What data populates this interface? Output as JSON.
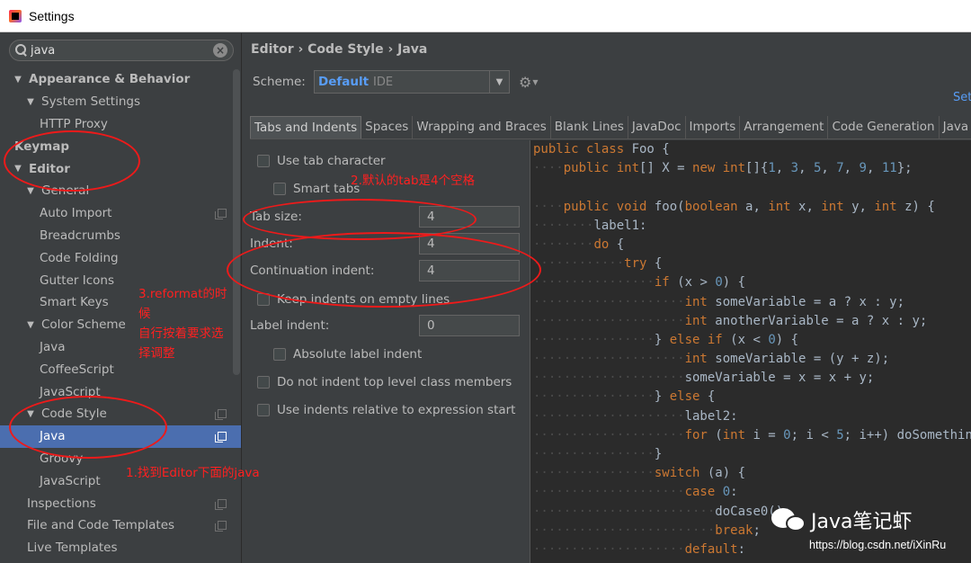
{
  "window": {
    "title": "Settings"
  },
  "search": {
    "value": "java"
  },
  "tree": [
    {
      "label": "Appearance & Behavior",
      "arrow": "▼",
      "indent": 14,
      "bold": true
    },
    {
      "label": "System Settings",
      "arrow": "▼",
      "indent": 28,
      "bold": false
    },
    {
      "label": "HTTP Proxy",
      "arrow": "",
      "indent": 44,
      "bold": false
    },
    {
      "label": "Keymap",
      "arrow": "",
      "indent": 16,
      "bold": true
    },
    {
      "label": "Editor",
      "arrow": "▼",
      "indent": 14,
      "bold": true
    },
    {
      "label": "General",
      "arrow": "▼",
      "indent": 28,
      "bold": false
    },
    {
      "label": "Auto Import",
      "arrow": "",
      "indent": 44,
      "bold": false,
      "copy": true
    },
    {
      "label": "Breadcrumbs",
      "arrow": "",
      "indent": 44,
      "bold": false
    },
    {
      "label": "Code Folding",
      "arrow": "",
      "indent": 44,
      "bold": false
    },
    {
      "label": "Gutter Icons",
      "arrow": "",
      "indent": 44,
      "bold": false
    },
    {
      "label": "Smart Keys",
      "arrow": "",
      "indent": 44,
      "bold": false
    },
    {
      "label": "Color Scheme",
      "arrow": "▼",
      "indent": 28,
      "bold": false
    },
    {
      "label": "Java",
      "arrow": "",
      "indent": 44,
      "bold": false
    },
    {
      "label": "CoffeeScript",
      "arrow": "",
      "indent": 44,
      "bold": false
    },
    {
      "label": "JavaScript",
      "arrow": "",
      "indent": 44,
      "bold": false
    },
    {
      "label": "Code Style",
      "arrow": "▼",
      "indent": 28,
      "bold": false,
      "copy": true
    },
    {
      "label": "Java",
      "arrow": "",
      "indent": 44,
      "bold": false,
      "copy": true,
      "selected": true
    },
    {
      "label": "Groovy",
      "arrow": "",
      "indent": 44,
      "bold": false
    },
    {
      "label": "JavaScript",
      "arrow": "",
      "indent": 44,
      "bold": false
    },
    {
      "label": "Inspections",
      "arrow": "",
      "indent": 30,
      "bold": false,
      "copy": true
    },
    {
      "label": "File and Code Templates",
      "arrow": "",
      "indent": 30,
      "bold": false,
      "copy": true
    },
    {
      "label": "Live Templates",
      "arrow": "",
      "indent": 30,
      "bold": false
    }
  ],
  "breadcrumb": "Editor › Code Style › Java",
  "scheme": {
    "label": "Scheme:",
    "name": "Default",
    "type": "IDE",
    "set_link": "Set"
  },
  "tabs": [
    "Tabs and Indents",
    "Spaces",
    "Wrapping and Braces",
    "Blank Lines",
    "JavaDoc",
    "Imports",
    "Arrangement",
    "Code Generation",
    "Java EE Names"
  ],
  "options": {
    "use_tab_character": "Use tab character",
    "smart_tabs": "Smart tabs",
    "tab_size_label": "Tab size:",
    "tab_size": "4",
    "indent_label": "Indent:",
    "indent": "4",
    "continuation_indent_label": "Continuation indent:",
    "continuation_indent": "4",
    "keep_indents": "Keep indents on empty lines",
    "label_indent_label": "Label indent:",
    "label_indent": "0",
    "absolute_label_indent": "Absolute label indent",
    "no_indent_top_level": "Do not indent top level class members",
    "indents_relative": "Use indents relative to expression start"
  },
  "code": [
    [
      [
        "kw",
        "public class "
      ],
      [
        "t",
        "Foo {"
      ]
    ],
    [
      [
        "d",
        "····"
      ],
      [
        "kw",
        "public int"
      ],
      [
        "t",
        "[] X = "
      ],
      [
        "kw",
        "new int"
      ],
      [
        "t",
        "[]{"
      ],
      [
        "num",
        "1"
      ],
      [
        "t",
        ", "
      ],
      [
        "num",
        "3"
      ],
      [
        "t",
        ", "
      ],
      [
        "num",
        "5"
      ],
      [
        "t",
        ", "
      ],
      [
        "num",
        "7"
      ],
      [
        "t",
        ", "
      ],
      [
        "num",
        "9"
      ],
      [
        "t",
        ", "
      ],
      [
        "num",
        "11"
      ],
      [
        "t",
        "};"
      ]
    ],
    [
      [
        "d",
        ""
      ]
    ],
    [
      [
        "d",
        "····"
      ],
      [
        "kw",
        "public void "
      ],
      [
        "t",
        "foo("
      ],
      [
        "kw",
        "boolean "
      ],
      [
        "t",
        "a, "
      ],
      [
        "kw",
        "int "
      ],
      [
        "t",
        "x, "
      ],
      [
        "kw",
        "int "
      ],
      [
        "t",
        "y, "
      ],
      [
        "kw",
        "int "
      ],
      [
        "t",
        "z) {"
      ]
    ],
    [
      [
        "d",
        "········"
      ],
      [
        "t",
        "label1:"
      ]
    ],
    [
      [
        "d",
        "········"
      ],
      [
        "kw",
        "do "
      ],
      [
        "t",
        "{"
      ]
    ],
    [
      [
        "d",
        "············"
      ],
      [
        "kw",
        "try "
      ],
      [
        "t",
        "{"
      ]
    ],
    [
      [
        "d",
        "················"
      ],
      [
        "kw",
        "if "
      ],
      [
        "t",
        "(x > "
      ],
      [
        "num",
        "0"
      ],
      [
        "t",
        ") {"
      ]
    ],
    [
      [
        "d",
        "····················"
      ],
      [
        "kw",
        "int "
      ],
      [
        "t",
        "someVariable = a ? x : y;"
      ]
    ],
    [
      [
        "d",
        "····················"
      ],
      [
        "kw",
        "int "
      ],
      [
        "t",
        "anotherVariable = a ? x : y;"
      ]
    ],
    [
      [
        "d",
        "················"
      ],
      [
        "t",
        "} "
      ],
      [
        "kw",
        "else if "
      ],
      [
        "t",
        "(x < "
      ],
      [
        "num",
        "0"
      ],
      [
        "t",
        ") {"
      ]
    ],
    [
      [
        "d",
        "····················"
      ],
      [
        "kw",
        "int "
      ],
      [
        "t",
        "someVariable = (y + z);"
      ]
    ],
    [
      [
        "d",
        "····················"
      ],
      [
        "t",
        "someVariable = x = x + y;"
      ]
    ],
    [
      [
        "d",
        "················"
      ],
      [
        "t",
        "} "
      ],
      [
        "kw",
        "else "
      ],
      [
        "t",
        "{"
      ]
    ],
    [
      [
        "d",
        "····················"
      ],
      [
        "t",
        "label2:"
      ]
    ],
    [
      [
        "d",
        "····················"
      ],
      [
        "kw",
        "for "
      ],
      [
        "t",
        "("
      ],
      [
        "kw",
        "int "
      ],
      [
        "t",
        "i = "
      ],
      [
        "num",
        "0"
      ],
      [
        "t",
        "; i < "
      ],
      [
        "num",
        "5"
      ],
      [
        "t",
        "; i++) doSomething(i);"
      ]
    ],
    [
      [
        "d",
        "················"
      ],
      [
        "t",
        "}"
      ]
    ],
    [
      [
        "d",
        "················"
      ],
      [
        "kw",
        "switch "
      ],
      [
        "t",
        "(a) {"
      ]
    ],
    [
      [
        "d",
        "····················"
      ],
      [
        "kw",
        "case "
      ],
      [
        "num",
        "0"
      ],
      [
        "t",
        ":"
      ]
    ],
    [
      [
        "d",
        "························"
      ],
      [
        "t",
        "doCase0();"
      ]
    ],
    [
      [
        "d",
        "························"
      ],
      [
        "kw",
        "break"
      ],
      [
        "t",
        ";"
      ]
    ],
    [
      [
        "d",
        "····················"
      ],
      [
        "kw",
        "default"
      ],
      [
        "t",
        ":"
      ]
    ]
  ],
  "annotations": {
    "a1": "1.找到Editor下面的java",
    "a2": "2.默认的tab是4个空格",
    "a3_line1": "3.reformat的时",
    "a3_line2": "候",
    "a3_line3": "自行按着要求选",
    "a3_line4": "择调整"
  },
  "watermark": {
    "brand": "Java笔记虾",
    "url": "https://blog.csdn.net/iXinRu"
  }
}
